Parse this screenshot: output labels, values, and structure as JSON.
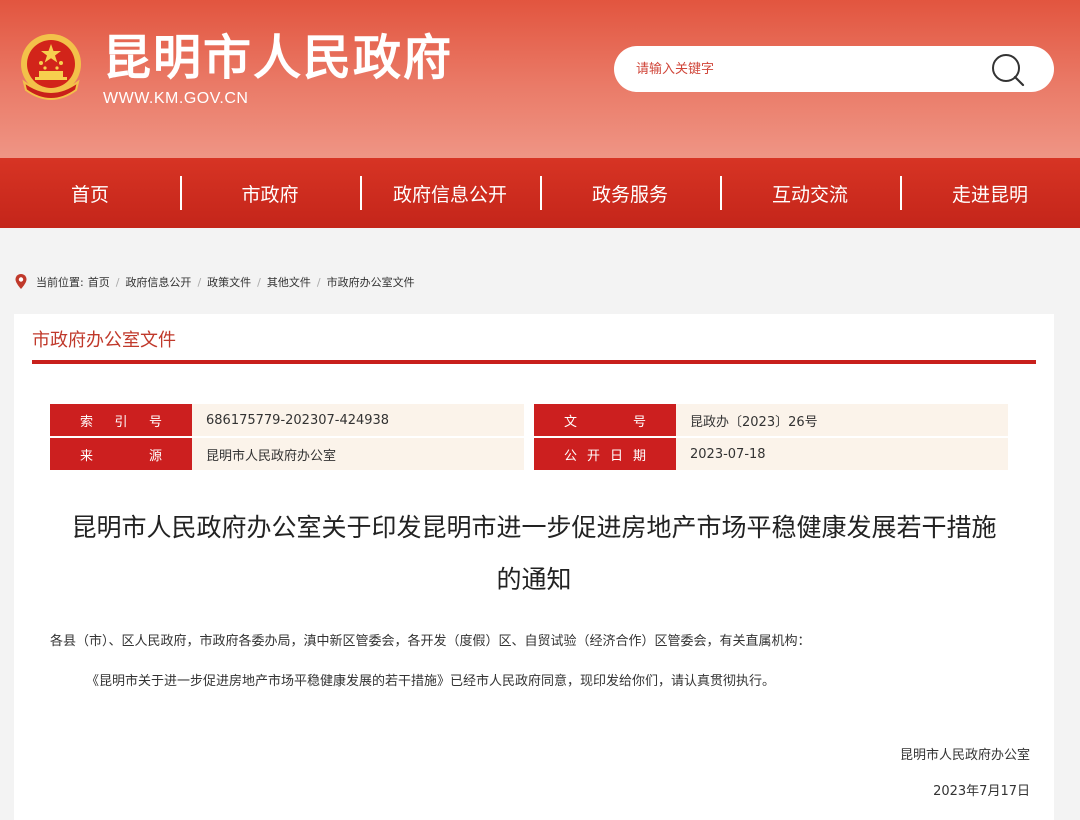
{
  "header": {
    "site_title": "昆明市人民政府",
    "site_url": "WWW.KM.GOV.CN",
    "search_placeholder": "请输入关键字"
  },
  "nav": {
    "items": [
      "首页",
      "市政府",
      "政府信息公开",
      "政务服务",
      "互动交流",
      "走进昆明"
    ]
  },
  "breadcrumb": {
    "prefix": "当前位置:",
    "items": [
      "首页",
      "政府信息公开",
      "政策文件",
      "其他文件",
      "市政府办公室文件"
    ]
  },
  "section": {
    "title": "市政府办公室文件"
  },
  "meta": {
    "index_label_chars": [
      "索",
      "引",
      "号"
    ],
    "index_value": "686175779-202307-424938",
    "docno_label_chars": [
      "文",
      "号"
    ],
    "docno_value": "昆政办〔2023〕26号",
    "source_label_chars": [
      "来",
      "源"
    ],
    "source_value": "昆明市人民政府办公室",
    "date_label_chars": [
      "公",
      "开",
      "日",
      "期"
    ],
    "date_value": "2023-07-18"
  },
  "document": {
    "title_line1": "昆明市人民政府办公室关于印发昆明市进一步促进房地产市场平稳健康发展若干措施",
    "title_line2": "的通知",
    "salutation": "各县（市）、区人民政府，市政府各委办局，滇中新区管委会，各开发（度假）区、自贸试验（经济合作）区管委会，有关直属机构：",
    "paragraph": "《昆明市关于进一步促进房地产市场平稳健康发展的若干措施》已经市人民政府同意，现印发给你们，请认真贯彻执行。",
    "signer": "昆明市人民政府办公室",
    "sign_date": "2023年7月17日"
  },
  "colors": {
    "header_red": "#e2553f",
    "nav_red": "#c4251a",
    "label_red": "#cc1f1f",
    "value_bg": "#fbf3ea"
  }
}
